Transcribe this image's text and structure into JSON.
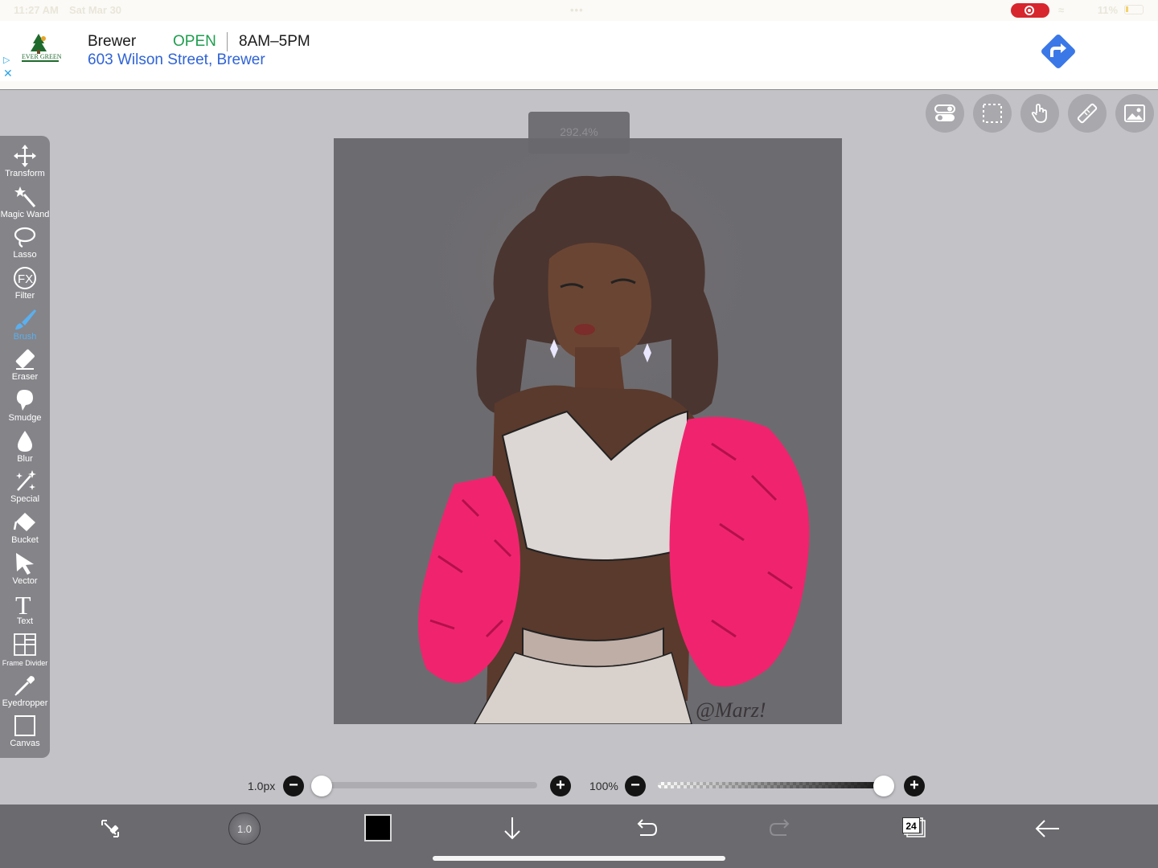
{
  "status_bar": {
    "time": "11:27 AM",
    "date": "Sat Mar 30",
    "dots": "•••",
    "battery": "11%"
  },
  "ad": {
    "logo_text": "EVER GREEN",
    "business_name": "Brewer",
    "status": "OPEN",
    "hours": "8AM–5PM",
    "address": "603 Wilson Street, Brewer"
  },
  "top_tools": [
    "toggle-icon",
    "selection-icon",
    "hand-icon",
    "ruler-icon",
    "gallery-icon"
  ],
  "canvas": {
    "zoom": "292.4%",
    "signature": "@Marz!"
  },
  "toolbar": {
    "items": [
      {
        "label": "Transform",
        "icon": "move-arrows-icon"
      },
      {
        "label": "Magic Wand",
        "icon": "magic-wand-icon"
      },
      {
        "label": "Lasso",
        "icon": "lasso-icon"
      },
      {
        "label": "Filter",
        "icon": "fx-icon"
      },
      {
        "label": "Brush",
        "icon": "brush-icon",
        "active": true
      },
      {
        "label": "Eraser",
        "icon": "eraser-icon"
      },
      {
        "label": "Smudge",
        "icon": "smudge-icon"
      },
      {
        "label": "Blur",
        "icon": "drop-icon"
      },
      {
        "label": "Special",
        "icon": "sparkle-icon"
      },
      {
        "label": "Bucket",
        "icon": "bucket-icon"
      },
      {
        "label": "Vector",
        "icon": "cursor-icon"
      },
      {
        "label": "Text",
        "icon": "text-icon"
      },
      {
        "label": "Frame Divider",
        "icon": "frame-divider-icon"
      },
      {
        "label": "Eyedropper",
        "icon": "eyedropper-icon"
      },
      {
        "label": "Canvas",
        "icon": "canvas-icon"
      }
    ],
    "active_color": "#5ab0ef"
  },
  "sliders": {
    "size_label": "1.0px",
    "size_value": 0.0,
    "opacity_label": "100%",
    "opacity_value": 1.0
  },
  "bottom_bar": {
    "brush_size": "1.0",
    "color": "#000000",
    "layers_count": "24"
  }
}
